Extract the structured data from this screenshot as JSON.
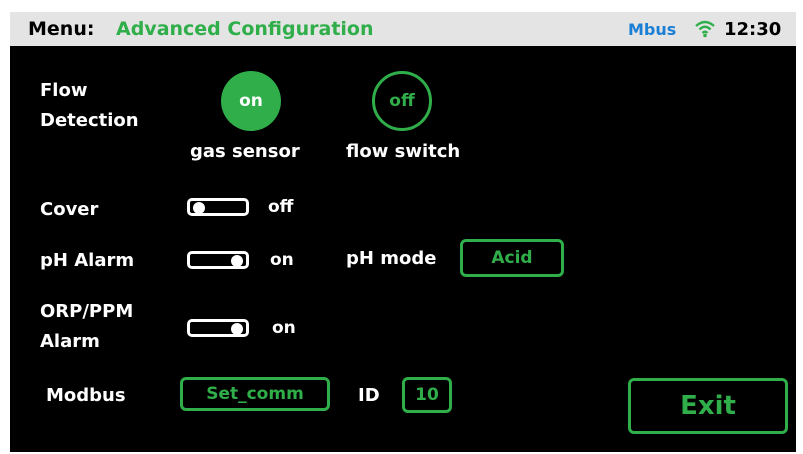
{
  "header": {
    "menu_label": "Menu:",
    "title": "Advanced Configuration",
    "connection": "Mbus",
    "signal_icon": "wifi-icon",
    "time": "12:30"
  },
  "flow_detection": {
    "label_line1": "Flow",
    "label_line2": "Detection",
    "options": [
      {
        "state": "on",
        "caption": "gas sensor",
        "selected": true
      },
      {
        "state": "off",
        "caption": "flow switch",
        "selected": false
      }
    ]
  },
  "cover": {
    "label": "Cover",
    "value": "off"
  },
  "ph_alarm": {
    "label": "pH Alarm",
    "value": "on"
  },
  "ph_mode": {
    "label": "pH mode",
    "value": "Acid"
  },
  "orp_alarm": {
    "label_line1": "ORP/PPM",
    "label_line2": "Alarm",
    "value": "on"
  },
  "modbus": {
    "label": "Modbus",
    "button": "Set_comm",
    "id_label": "ID",
    "id_value": "10"
  },
  "exit_label": "Exit",
  "colors": {
    "accent": "#2fae4a",
    "background": "#000000",
    "header": "#e4e4e4",
    "mbus": "#1c7fd6"
  }
}
